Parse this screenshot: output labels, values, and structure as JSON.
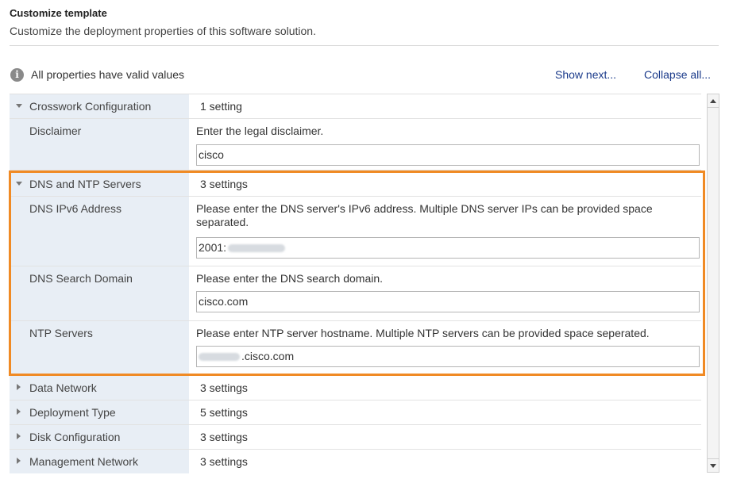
{
  "header": {
    "title": "Customize template",
    "subtitle": "Customize the deployment properties of this software solution."
  },
  "status": {
    "icon": "info-icon",
    "text": "All properties have valid values"
  },
  "actions": {
    "show_next": "Show next...",
    "collapse_all": "Collapse all..."
  },
  "highlight_color": "#f08a24",
  "groups": {
    "crosswork": {
      "label": "Crosswork Configuration",
      "count": "1 setting",
      "expanded": true,
      "properties": [
        {
          "label": "Disclaimer",
          "description": "Enter the legal disclaimer.",
          "value": "cisco"
        }
      ]
    },
    "dns": {
      "label": "DNS and NTP Servers",
      "count": "3 settings",
      "expanded": true,
      "properties": [
        {
          "label": "DNS IPv6 Address",
          "description": "Please enter the DNS server's IPv6 address. Multiple DNS server IPs can be provided space separated.",
          "value": "2001:"
        },
        {
          "label": "DNS Search Domain",
          "description": "Please enter the DNS search domain.",
          "value": "cisco.com"
        },
        {
          "label": "NTP Servers",
          "description": "Please enter NTP server hostname. Multiple NTP servers can be provided space seperated.",
          "value": ".cisco.com"
        }
      ]
    },
    "collapsed": [
      {
        "label": "Data Network",
        "count": "3 settings"
      },
      {
        "label": "Deployment Type",
        "count": "5 settings"
      },
      {
        "label": "Disk Configuration",
        "count": "3 settings"
      },
      {
        "label": "Management Network",
        "count": "3 settings"
      }
    ]
  }
}
